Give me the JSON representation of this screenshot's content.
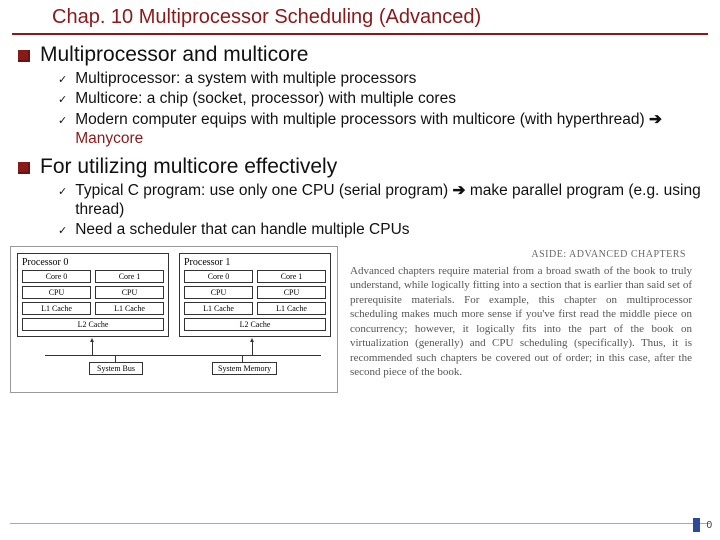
{
  "title": "Chap. 10 Multiprocessor Scheduling (Advanced)",
  "s1": {
    "head": "Multiprocessor and multicore",
    "items": [
      "Multiprocessor: a system with multiple processors",
      "Multicore: a chip (socket, processor) with multiple cores",
      "Modern computer equips with multiple processors with multicore (with hyperthread) "
    ],
    "hl": "Manycore"
  },
  "s2": {
    "head": "For utilizing multicore effectively",
    "items": {
      "a_pre": "Typical C program: use only one CPU (serial program) ",
      "a_post": " make parallel program (e.g. using thread)",
      "b": "Need a scheduler that can handle multiple CPUs"
    }
  },
  "arrow": "➔",
  "diagram": {
    "p0": "Processor 0",
    "p1": "Processor 1",
    "core0": "Core 0",
    "core1": "Core 1",
    "cpu": "CPU",
    "l1": "L1 Cache",
    "l2": "L2 Cache",
    "sysbus": "System Bus",
    "sysmem": "System Memory"
  },
  "aside": {
    "head": "ASIDE: ADVANCED CHAPTERS",
    "body": "Advanced chapters require material from a broad swath of the book to truly understand, while logically fitting into a section that is earlier than said set of prerequisite materials. For example, this chapter on multiprocessor scheduling makes much more sense if you've first read the middle piece on concurrency; however, it logically fits into the part of the book on virtualization (generally) and CPU scheduling (specifically). Thus, it is recommended such chapters be covered out of order; in this case, after the second piece of the book."
  },
  "page": "0"
}
